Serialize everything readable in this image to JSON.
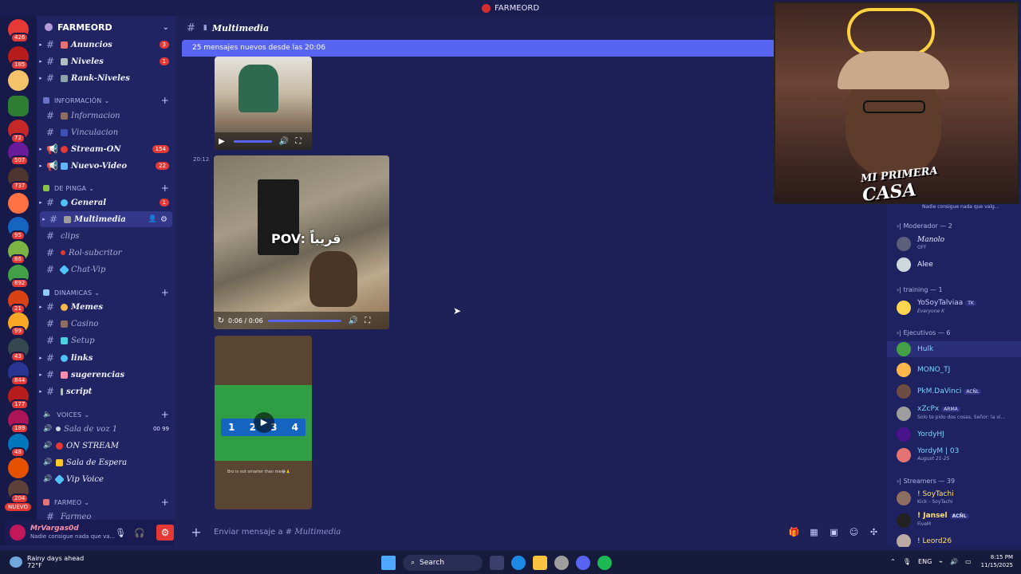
{
  "window": {
    "title": "FARMEORD"
  },
  "server": {
    "name": "FARMEORD"
  },
  "rail_badges": [
    "426",
    "185",
    "72",
    "507",
    "737",
    "95",
    "86",
    "892",
    "21",
    "99",
    "43",
    "844",
    "177",
    "189",
    "48",
    "204"
  ],
  "rail_new_label": "NUEVO",
  "channels_top": [
    {
      "name": "Anuncios",
      "count": "3"
    },
    {
      "name": "Niveles",
      "count": "1"
    },
    {
      "name": "Rank-Niveles",
      "count": ""
    }
  ],
  "categories": {
    "informacion": "INFORMACIÓN",
    "de_pinga": "DE PINGA",
    "dinamicas": "DINAMICAS",
    "voices": "VOICES",
    "farmeo": "FARMEO"
  },
  "channels_info": [
    {
      "name": "Informacion",
      "count": ""
    },
    {
      "name": "Vinculacion",
      "count": ""
    },
    {
      "name": "Stream-ON",
      "count": "154"
    },
    {
      "name": "Nuevo-Video",
      "count": "22"
    }
  ],
  "channels_pinga": [
    {
      "name": "General",
      "count": "1"
    },
    {
      "name": "Multimedia",
      "count": ""
    },
    {
      "name": "clips",
      "count": ""
    },
    {
      "name": "Rol-subcritor",
      "count": ""
    },
    {
      "name": "Chat-Vip",
      "count": ""
    }
  ],
  "channels_dinamicas": [
    {
      "name": "Memes"
    },
    {
      "name": "Casino"
    },
    {
      "name": "Setup"
    },
    {
      "name": "links"
    },
    {
      "name": "sugerencias"
    },
    {
      "name": "script"
    }
  ],
  "voices": [
    {
      "name": "Sala de voz 1",
      "extra": "00  99"
    },
    {
      "name": "ON STREAM",
      "extra": ""
    },
    {
      "name": "Sala de Espera",
      "extra": ""
    },
    {
      "name": "Vip Voice",
      "extra": ""
    }
  ],
  "farmeo_first": "Farmeo",
  "user": {
    "name": "MrVargas0d",
    "status": "Nadie consigue nada que va..."
  },
  "header": {
    "channel": "Multimedia"
  },
  "new_messages": "25 mensajes nuevos desde las 20:06",
  "message": {
    "time": "20:12",
    "video_time": "0:06 / 0:06",
    "overlay_text": "POV: قريباً",
    "game_digits": [
      "1",
      "2",
      "3",
      "4"
    ],
    "caption": "Bro is not smarter than me😂🙏"
  },
  "composer": {
    "placeholder_prefix": "Enviar mensaje a #",
    "channel": "Multimedia"
  },
  "webcam": {
    "line1": "MI PRIMERA",
    "line2": "CASA"
  },
  "members": {
    "status_line": "Nadie consigue nada que valg...",
    "groups": [
      {
        "header": "Moderador — 2",
        "members": [
          {
            "name": "Manolo",
            "sub": "OFF",
            "tag": "",
            "color": "#c9ccff"
          },
          {
            "name": "Alee",
            "sub": "",
            "tag": "",
            "color": "#e8eaff"
          }
        ]
      },
      {
        "header": "training — 1",
        "members": [
          {
            "name": "YoSoyTalviaa",
            "sub": "Everyone K",
            "tag": "TK",
            "color": "#c9ccff"
          }
        ]
      },
      {
        "header": "Ejecutivos — 6",
        "members": [
          {
            "name": "Hulk",
            "sub": "",
            "tag": "",
            "color": "#7cd4ff"
          },
          {
            "name": "MONO_TJ",
            "sub": "",
            "tag": "",
            "color": "#7cd4ff"
          },
          {
            "name": "PkM.DaVinci",
            "sub": "",
            "tag": "ACÑL",
            "color": "#7cd4ff"
          },
          {
            "name": "xZcPx",
            "sub": "Solo te pido dos cosas, Señor: la vi...",
            "tag": "ARMA",
            "color": "#7cd4ff"
          },
          {
            "name": "YordyHJ",
            "sub": "",
            "tag": "",
            "color": "#7cd4ff"
          },
          {
            "name": "YordyM | 03",
            "sub": "August 21-25",
            "tag": "",
            "color": "#7cd4ff"
          }
        ]
      },
      {
        "header": "Streamers — 39",
        "members": [
          {
            "name": "! SoyTachi",
            "sub": "Kick - SoyTachi",
            "tag": "",
            "color": "#ffe06b"
          },
          {
            "name": "! Jansel",
            "sub": "FiveM",
            "tag": "ACÑL",
            "color": "#ffe06b"
          },
          {
            "name": "! Leord26",
            "sub": "",
            "tag": "",
            "color": "#ffe06b"
          }
        ]
      }
    ]
  },
  "taskbar": {
    "weather_title": "Rainy days ahead",
    "weather_temp": "72°F",
    "search": "Search",
    "lang": "ENG",
    "time": "8:15 PM",
    "date": "11/15/2025"
  },
  "colors": {
    "accent": "#5865f2",
    "badge": "#e53935",
    "sidebar": "#212463",
    "main": "#1e2158"
  }
}
